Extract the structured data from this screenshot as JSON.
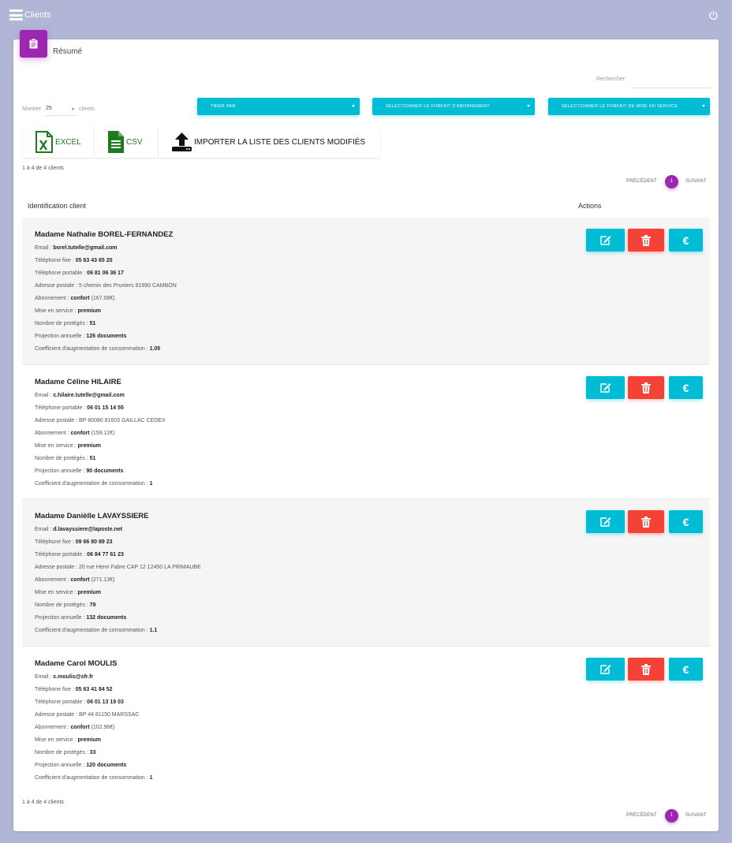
{
  "app": {
    "title": "Clients"
  },
  "card": {
    "title": "Résumé"
  },
  "search": {
    "label": "Rechercher:",
    "value": ""
  },
  "length": {
    "show_label": "Montrer",
    "value": "25",
    "suffix_label": "clients"
  },
  "filters": {
    "sort_label": "TRIER PAR",
    "subscription_label": "SÉLECTIONNER LE FORFAIT D'ABONNEMENT",
    "service_label": "SÉLECTIONNER LE FORFAIT DE MISE EN SERVICE"
  },
  "export": {
    "excel_label": "EXCEL",
    "csv_label": "CSV",
    "import_label": "IMPORTER LA LISTE DES CLIENTS MODIFIÉS"
  },
  "info": {
    "text": "1 à 4 de 4 clients"
  },
  "pagination": {
    "previous": "PRÉCÉDENT",
    "current": "1",
    "next": "SUIVANT"
  },
  "table": {
    "headers": [
      "Identification client",
      "Actions"
    ]
  },
  "labels": {
    "email": "Email : ",
    "landline": "Téléphone fixe : ",
    "mobile": "Téléphone portable : ",
    "address": "Adresse postale : ",
    "subscription": "Abonnement : ",
    "service": "Mise en service : ",
    "protected": "Nombre de protégés : ",
    "projection": "Projection annuelle : ",
    "coefficient": "Coefficient d'augmentation de consommation : "
  },
  "action_icons": {
    "edit": "edit-icon",
    "delete": "trash-icon",
    "euro": "euro-icon"
  },
  "action_text": {
    "euro": "€"
  },
  "clients": [
    {
      "name": "Madame Nathalie BOREL-FERNANDEZ",
      "email": "borel.tutelle@gmail.com",
      "landline": "05 63 43 65 20",
      "mobile": "06 81 06 36 17",
      "address": "5 chemin des Pruniers 81990 CAMBON",
      "subscription": "confort",
      "subscription_price": " (167.08€)",
      "service": "premium",
      "protected": "51",
      "projection": "126 documents",
      "coefficient": "1.05"
    },
    {
      "name": "Madame Céline HILAIRE",
      "email": "c.hilaire.tutelle@gmail.com",
      "mobile": "06 01 15 14 55",
      "address": "BP 80080 81603 GAILLAC CEDEX",
      "subscription": "confort",
      "subscription_price": " (159.12€)",
      "service": "premium",
      "protected": "51",
      "projection": "90 documents",
      "coefficient": "1"
    },
    {
      "name": "Madame Danièlle LAVAYSSIERE",
      "email": "d.lavayssiere@laposte.net",
      "landline": "09 66 80 89 23",
      "mobile": "06 84 77 61 23",
      "address": "20 rue Henri Fabre CAP 12 12450 LA PRIMAUBE",
      "subscription": "confort",
      "subscription_price": " (271.13€)",
      "service": "premium",
      "protected": "79",
      "projection": "132 documents",
      "coefficient": "1.1"
    },
    {
      "name": "Madame Carol MOULIS",
      "email": "c.moulis@sfr.fr",
      "landline": "05 63 41 84 52",
      "mobile": "06 01 13 19 03",
      "address": "BP 44 81150 MARSSAC",
      "subscription": "confort",
      "subscription_price": " (102.96€)",
      "service": "premium",
      "protected": "33",
      "projection": "120 documents",
      "coefficient": "1"
    }
  ]
}
